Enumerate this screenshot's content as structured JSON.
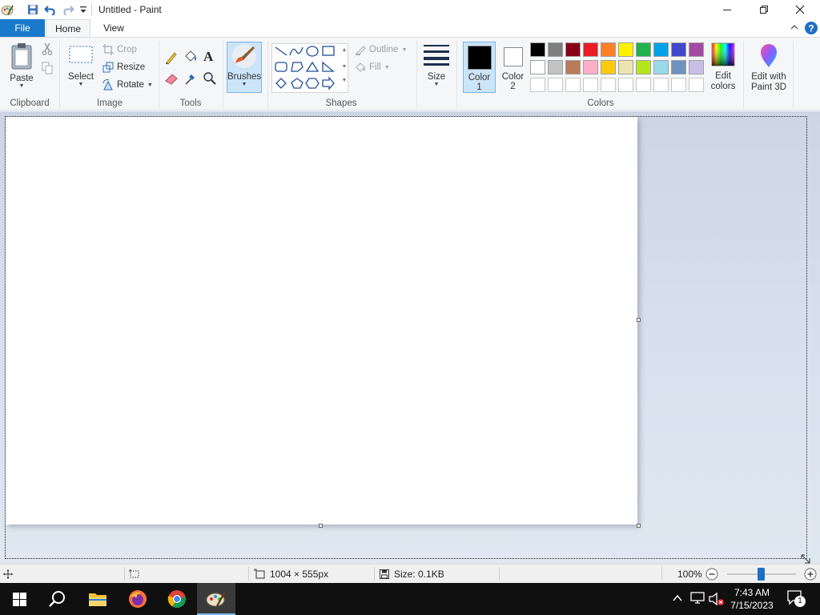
{
  "window": {
    "title": "Untitled - Paint"
  },
  "tabs": {
    "file": "File",
    "home": "Home",
    "view": "View"
  },
  "ribbon": {
    "clipboard": {
      "paste": "Paste",
      "group_label": "Clipboard"
    },
    "image": {
      "select": "Select",
      "crop": "Crop",
      "resize": "Resize",
      "rotate": "Rotate",
      "group_label": "Image"
    },
    "tools": {
      "group_label": "Tools",
      "text_tool_glyph": "A"
    },
    "brushes": {
      "label": "Brushes"
    },
    "shapes": {
      "outline": "Outline",
      "fill": "Fill",
      "group_label": "Shapes"
    },
    "size": {
      "label": "Size"
    },
    "colors": {
      "color1_label": "Color",
      "color1_index": "1",
      "color2_label": "Color",
      "color2_index": "2",
      "color1_value": "#000000",
      "color2_value": "#ffffff",
      "edit_colors_line1": "Edit",
      "edit_colors_line2": "colors",
      "group_label": "Colors",
      "palette_row1": [
        "#000000",
        "#7f7f7f",
        "#880015",
        "#ed1c24",
        "#ff7f27",
        "#fff200",
        "#22b14c",
        "#00a2e8",
        "#3f48cc",
        "#a349a4"
      ],
      "palette_row2": [
        "#ffffff",
        "#c3c3c3",
        "#b97a57",
        "#ffaec9",
        "#ffc90e",
        "#efe4b0",
        "#b5e61d",
        "#99d9ea",
        "#7092be",
        "#c8bfe7"
      ]
    },
    "paint3d": {
      "line1": "Edit with",
      "line2": "Paint 3D"
    }
  },
  "statusbar": {
    "dimensions": "1004 × 555px",
    "size": "Size: 0.1KB",
    "zoom": "100%"
  },
  "taskbar": {
    "time": "7:43 AM",
    "date": "7/15/2023",
    "notification_count": "1"
  }
}
